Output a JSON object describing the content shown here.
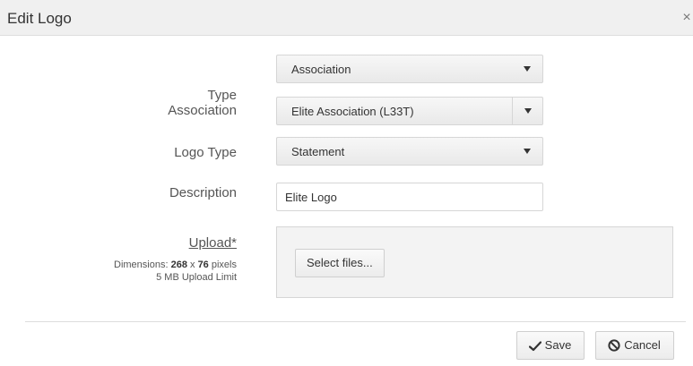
{
  "dialog": {
    "title": "Edit Logo",
    "close_glyph": "×",
    "close_icon": "close-icon"
  },
  "form": {
    "type": {
      "label": "Type",
      "value": "Association"
    },
    "association": {
      "label": "Association",
      "value": "Elite Association (L33T)"
    },
    "logo_type": {
      "label": "Logo Type",
      "value": "Statement"
    },
    "description": {
      "label": "Description",
      "value": "Elite Logo"
    },
    "upload": {
      "label": "Upload*",
      "dimensions_prefix": "Dimensions: ",
      "width": "268",
      "by": " x ",
      "height": "76",
      "unit": " pixels",
      "limit": "5 MB Upload Limit",
      "select_button": "Select files..."
    }
  },
  "footer": {
    "save_label": "Save",
    "save_icon": "check-icon",
    "cancel_label": "Cancel",
    "cancel_icon": "ban-icon"
  }
}
